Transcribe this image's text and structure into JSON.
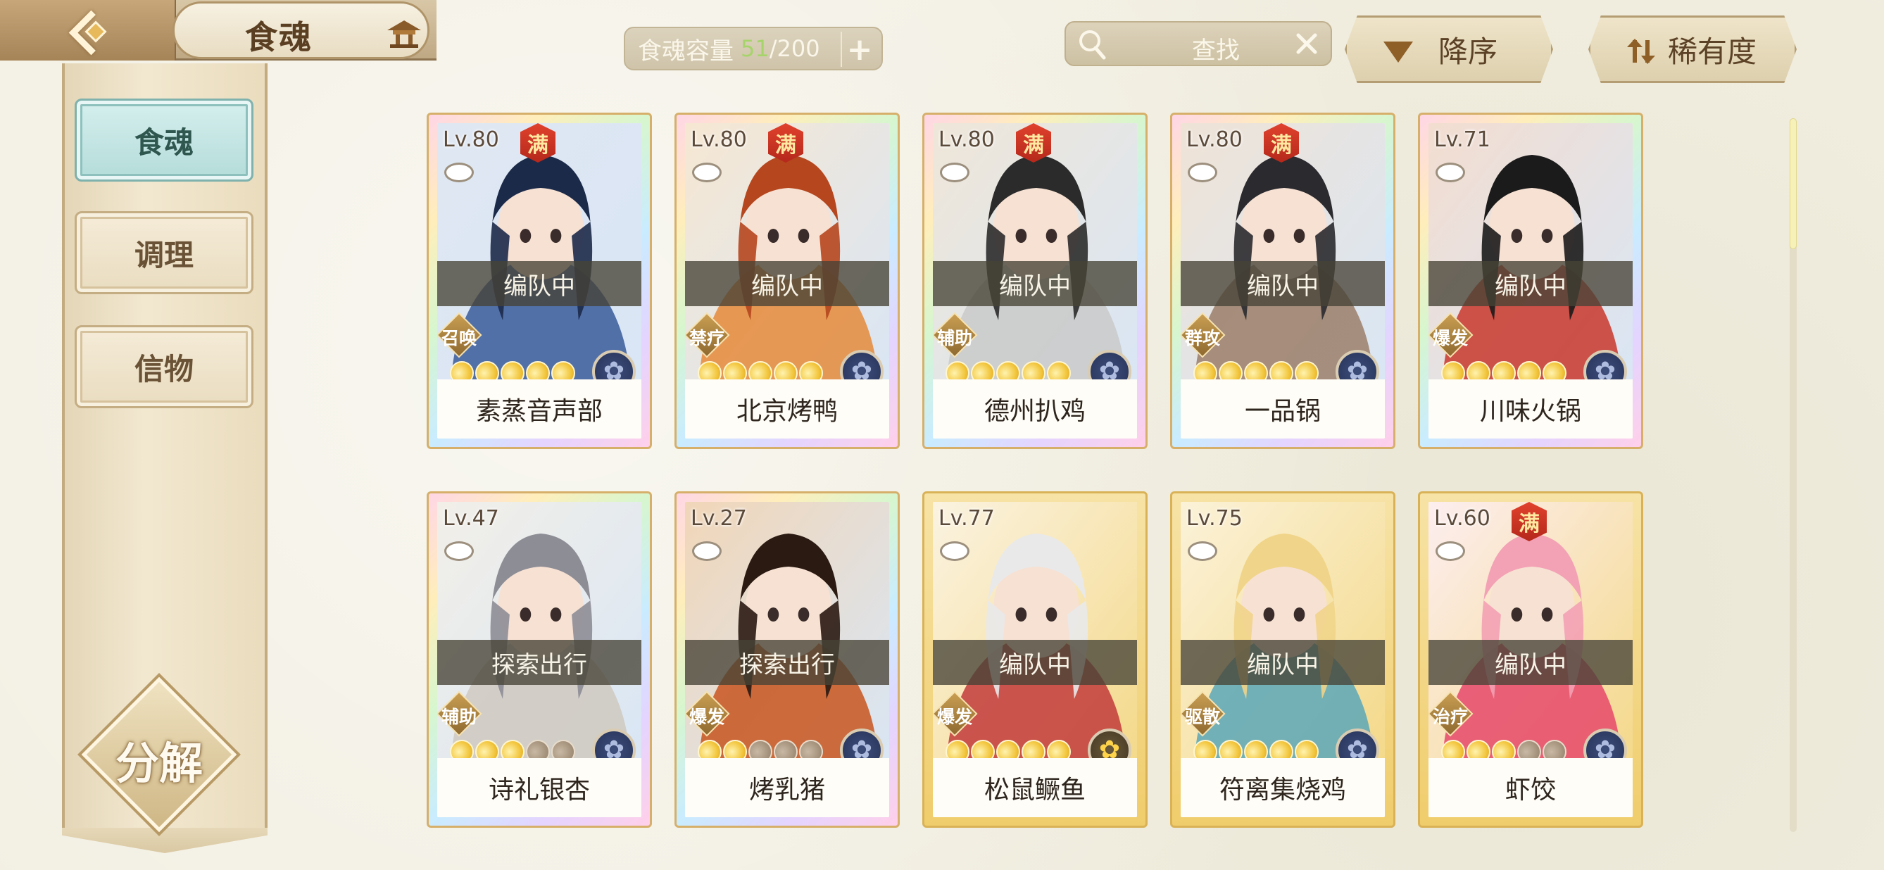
{
  "header": {
    "title": "食魂"
  },
  "capacity": {
    "label": "食魂容量",
    "current": "51",
    "separator": "/",
    "max": "200",
    "add": "+"
  },
  "search": {
    "placeholder": "查找"
  },
  "sort": {
    "order_label": "降序",
    "field_label": "稀有度"
  },
  "sidebar": {
    "items": [
      {
        "label": "食魂",
        "active": true
      },
      {
        "label": "调理",
        "active": false
      },
      {
        "label": "信物",
        "active": false
      }
    ],
    "decompose_label": "分解"
  },
  "full_badge": "满",
  "cards": [
    {
      "level": "Lv.80",
      "full": true,
      "status": "编队中",
      "role": "召唤",
      "stars": 5,
      "name": "素蒸音声部",
      "frame": "rainbow",
      "element": "blue"
    },
    {
      "level": "Lv.80",
      "full": true,
      "status": "编队中",
      "role": "禁疗",
      "stars": 5,
      "name": "北京烤鸭",
      "frame": "rainbow",
      "element": "blue"
    },
    {
      "level": "Lv.80",
      "full": true,
      "status": "编队中",
      "role": "辅助",
      "stars": 5,
      "name": "德州扒鸡",
      "frame": "rainbow",
      "element": "blue"
    },
    {
      "level": "Lv.80",
      "full": true,
      "status": "编队中",
      "role": "群攻",
      "stars": 5,
      "name": "一品锅",
      "frame": "rainbow",
      "element": "blue"
    },
    {
      "level": "Lv.71",
      "full": false,
      "status": "编队中",
      "role": "爆发",
      "stars": 5,
      "name": "川味火锅",
      "frame": "rainbow",
      "element": "blue"
    },
    {
      "level": "Lv.47",
      "full": false,
      "status": "探索出行",
      "role": "辅助",
      "stars": 3,
      "name": "诗礼银杏",
      "frame": "rainbow",
      "element": "blue"
    },
    {
      "level": "Lv.27",
      "full": false,
      "status": "探索出行",
      "role": "爆发",
      "stars": 2,
      "name": "烤乳猪",
      "frame": "rainbow",
      "element": "blue"
    },
    {
      "level": "Lv.77",
      "full": false,
      "status": "编队中",
      "role": "爆发",
      "stars": 5,
      "name": "松鼠鳜鱼",
      "frame": "gold",
      "element": "gold"
    },
    {
      "level": "Lv.75",
      "full": false,
      "status": "编队中",
      "role": "驱散",
      "stars": 5,
      "name": "符离集烧鸡",
      "frame": "gold",
      "element": "blue"
    },
    {
      "level": "Lv.60",
      "full": true,
      "status": "编队中",
      "role": "治疗",
      "stars": 3,
      "name": "虾饺",
      "frame": "gold",
      "element": "blue"
    }
  ],
  "colors": {
    "capacity_current": "#a6d46a",
    "active_tab": "#b4dcd9",
    "full_badge": "#c7301f"
  },
  "icons": {
    "back": "chevron-left-icon",
    "home": "pavilion-icon",
    "search": "magnifier-icon",
    "clear": "close-icon",
    "desc": "triangle-down-icon",
    "rarity": "sort-arrows-icon"
  }
}
